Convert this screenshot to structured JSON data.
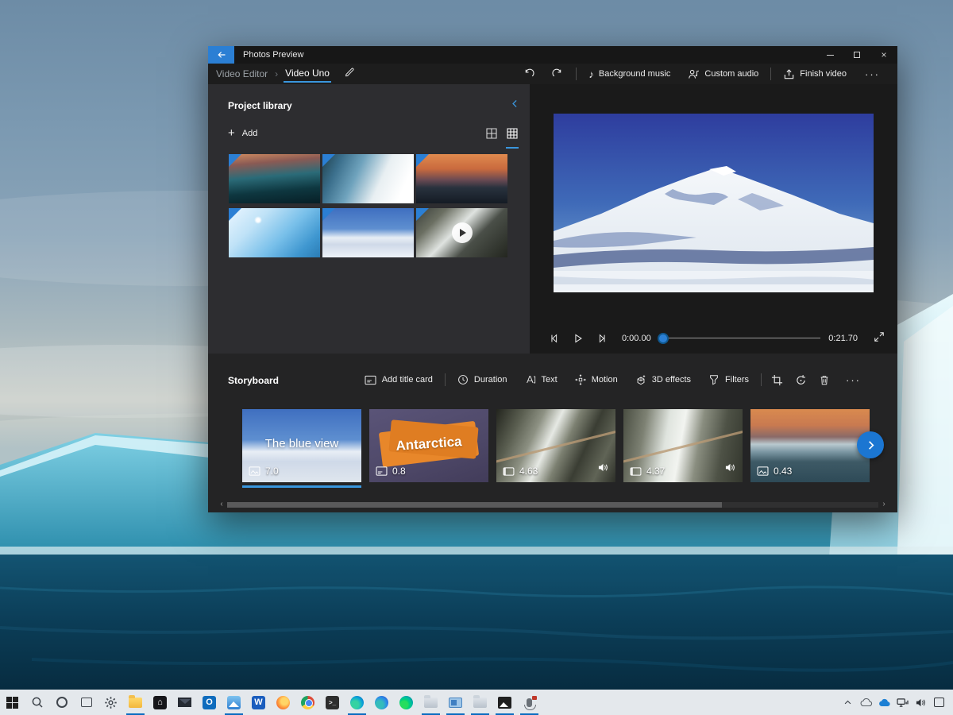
{
  "app": {
    "title": "Photos Preview"
  },
  "breadcrumb": {
    "parent": "Video Editor",
    "current": "Video Uno"
  },
  "toolbar": {
    "background_music": "Background music",
    "custom_audio": "Custom audio",
    "finish_video": "Finish video",
    "more": "···"
  },
  "library": {
    "title": "Project library",
    "add": "Add",
    "thumbnails": [
      "iceberg-teal-sunset",
      "iceberg-wall-closeup",
      "iceberg-orange-sunset",
      "iceberg-blue-slope",
      "snow-mountain",
      "rocky-waterfall-video"
    ]
  },
  "player": {
    "current": "0:00.00",
    "total": "0:21.70"
  },
  "storyboard": {
    "title": "Storyboard",
    "add_title_card": "Add title card",
    "duration": "Duration",
    "text": "Text",
    "motion": "Motion",
    "effects": "3D effects",
    "filters": "Filters",
    "more": "···",
    "clips": [
      {
        "type": "image",
        "label": "The blue view",
        "duration": "7.0",
        "selected": true
      },
      {
        "type": "title-card",
        "label": "Antarctica",
        "duration": "0.8"
      },
      {
        "type": "video",
        "duration": "4.63",
        "audio": true
      },
      {
        "type": "video",
        "duration": "4.37",
        "audio": true
      },
      {
        "type": "image",
        "duration": "0.43"
      }
    ]
  },
  "taskbar": {
    "icons": [
      "start",
      "search",
      "cortana",
      "task-view",
      "settings",
      "file-explorer",
      "microsoft-store",
      "mail",
      "outlook",
      "photos",
      "word",
      "firefox",
      "chrome",
      "terminal",
      "edge",
      "edge-beta",
      "edge-canary",
      "folder",
      "app-window",
      "folder",
      "image-viewer",
      "microphone"
    ],
    "active": [
      "file-explorer",
      "photos",
      "edge",
      "folder",
      "app-window",
      "image-viewer",
      "microphone"
    ],
    "tray": [
      "show-hidden",
      "onedrive-gray",
      "onedrive-blue",
      "network",
      "volume",
      "action-center"
    ]
  },
  "colors": {
    "accent": "#2b7fd4",
    "window_bg": "#202020",
    "panel_bg": "#2d2d30",
    "taskbar_bg": "#e4e8ec"
  }
}
